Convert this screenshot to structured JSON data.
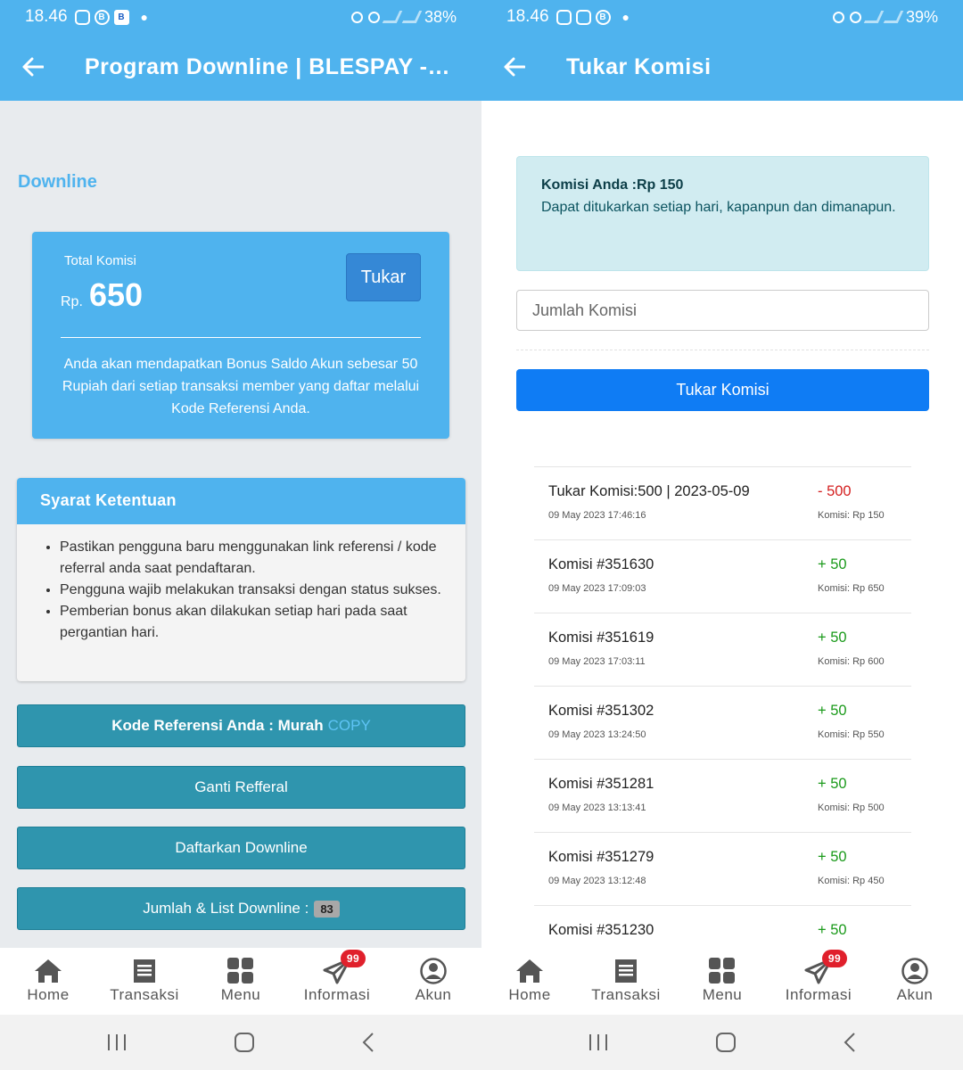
{
  "left": {
    "status": {
      "time": "18.46",
      "battery": "38%"
    },
    "appbar": {
      "title": "Program Downline | BLESPAY - PUL..."
    },
    "section_title": "Downline",
    "komisi_card": {
      "label": "Total Komisi",
      "currency": "Rp.",
      "amount": "650",
      "tukar_label": "Tukar",
      "description": "Anda akan mendapatkan Bonus Saldo Akun sebesar 50 Rupiah dari setiap transaksi member yang daftar melalui Kode Referensi Anda."
    },
    "syarat": {
      "title": "Syarat Ketentuan",
      "items": [
        "Pastikan pengguna baru menggunakan link referensi / kode referral anda saat pendaftaran.",
        "Pengguna wajib melakukan transaksi dengan status sukses.",
        "Pemberian bonus akan dilakukan setiap hari pada saat pergantian hari."
      ]
    },
    "buttons": {
      "kode_label": "Kode Referensi Anda : Murah",
      "copy_label": "COPY",
      "ganti_label": "Ganti Refferal",
      "daftar_label": "Daftarkan Downline",
      "jumlah_label": "Jumlah & List Downline :",
      "jumlah_count": "83"
    }
  },
  "right": {
    "status": {
      "time": "18.46",
      "battery": "39%"
    },
    "appbar": {
      "title": "Tukar Komisi"
    },
    "alert": {
      "heading": "Komisi Anda :Rp 150",
      "text": "Dapat ditukarkan setiap hari, kapanpun dan dimanapun."
    },
    "input_placeholder": "Jumlah Komisi",
    "submit_label": "Tukar Komisi",
    "history": [
      {
        "title": "Tukar Komisi:500 | 2023-05-09",
        "date": "09 May 2023 17:46:16",
        "amount": "- 500",
        "type": "neg",
        "balance": "Komisi: Rp 150"
      },
      {
        "title": "Komisi #351630",
        "date": "09 May 2023 17:09:03",
        "amount": "+ 50",
        "type": "pos",
        "balance": "Komisi: Rp 650"
      },
      {
        "title": "Komisi #351619",
        "date": "09 May 2023 17:03:11",
        "amount": "+ 50",
        "type": "pos",
        "balance": "Komisi: Rp 600"
      },
      {
        "title": "Komisi #351302",
        "date": "09 May 2023 13:24:50",
        "amount": "+ 50",
        "type": "pos",
        "balance": "Komisi: Rp 550"
      },
      {
        "title": "Komisi #351281",
        "date": "09 May 2023 13:13:41",
        "amount": "+ 50",
        "type": "pos",
        "balance": "Komisi: Rp 500"
      },
      {
        "title": "Komisi #351279",
        "date": "09 May 2023 13:12:48",
        "amount": "+ 50",
        "type": "pos",
        "balance": "Komisi: Rp 450"
      },
      {
        "title": "Komisi #351230",
        "date": "",
        "amount": "+ 50",
        "type": "pos",
        "balance": ""
      }
    ]
  },
  "nav": {
    "items": [
      {
        "label": "Home",
        "icon": "home-icon"
      },
      {
        "label": "Transaksi",
        "icon": "receipt-icon"
      },
      {
        "label": "Menu",
        "icon": "grid-icon"
      },
      {
        "label": "Informasi",
        "icon": "send-icon"
      },
      {
        "label": "Akun",
        "icon": "account-icon"
      }
    ],
    "info_badge": "99"
  },
  "colors": {
    "primary": "#4fb3ee",
    "teal": "#2f95ae",
    "submit": "#0f7cf4",
    "negative": "#d42020",
    "positive": "#1a9a1a"
  }
}
